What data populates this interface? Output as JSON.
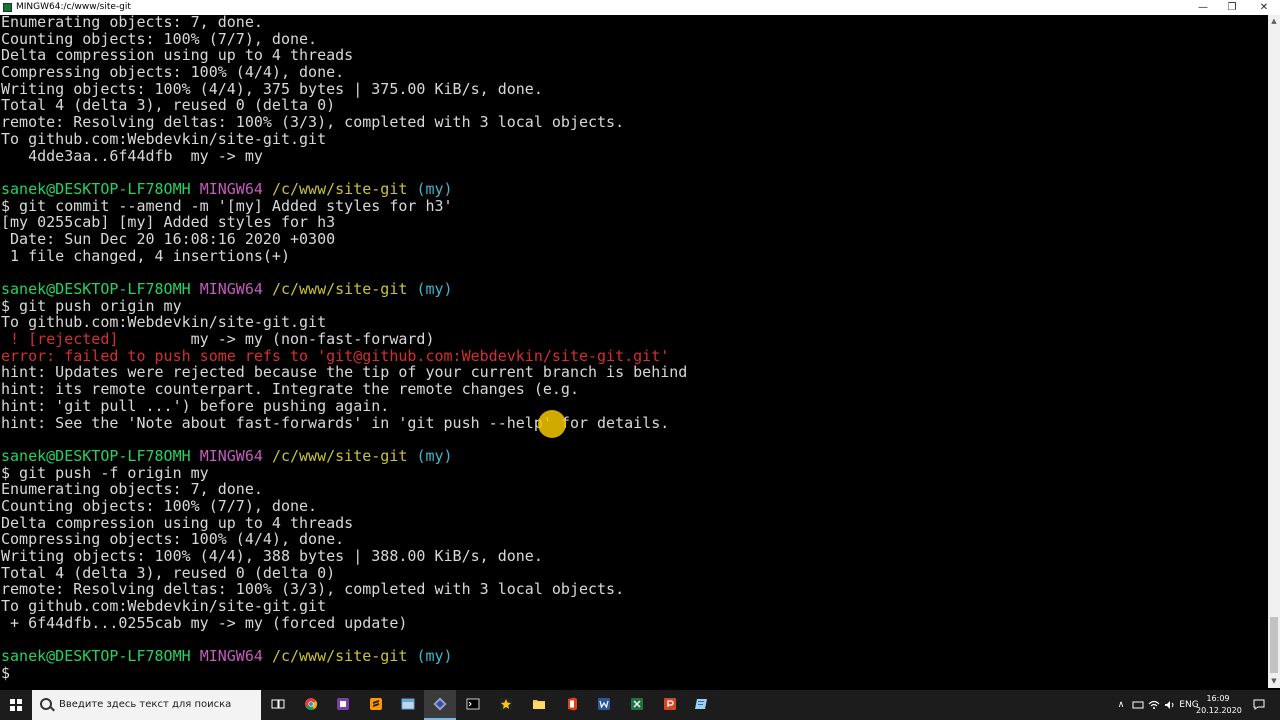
{
  "window": {
    "title": "MINGW64:/c/www/site-git",
    "minimize": "—",
    "maximize": "❐",
    "close": "✕"
  },
  "colors": {
    "user": "#23d35f",
    "mingw": "#c45cbd",
    "path": "#c9c23a",
    "branch": "#3fb6cc",
    "error": "#d32f2f",
    "text": "#d8d8d8"
  },
  "terminal": {
    "lines": [
      [
        {
          "t": "Enumerating objects: 7, done."
        }
      ],
      [
        {
          "t": "Counting objects: 100% (7/7), done."
        }
      ],
      [
        {
          "t": "Delta compression using up to 4 threads"
        }
      ],
      [
        {
          "t": "Compressing objects: 100% (4/4), done."
        }
      ],
      [
        {
          "t": "Writing objects: 100% (4/4), 375 bytes | 375.00 KiB/s, done."
        }
      ],
      [
        {
          "t": "Total 4 (delta 3), reused 0 (delta 0)"
        }
      ],
      [
        {
          "t": "remote: Resolving deltas: 100% (3/3), completed with 3 local objects."
        }
      ],
      [
        {
          "t": "To github.com:Webdevkin/site-git.git"
        }
      ],
      [
        {
          "t": "   4dde3aa..6f44dfb  my -> my"
        }
      ],
      [
        {
          "t": ""
        }
      ],
      [
        {
          "t": "sanek@DESKTOP-LF78OMH",
          "c": "user"
        },
        {
          "t": " "
        },
        {
          "t": "MINGW64",
          "c": "mingw"
        },
        {
          "t": " "
        },
        {
          "t": "/c/www/site-git",
          "c": "path"
        },
        {
          "t": " "
        },
        {
          "t": "(my)",
          "c": "branch"
        }
      ],
      [
        {
          "t": "$ git commit --amend -m '[my] Added styles for h3'"
        }
      ],
      [
        {
          "t": "[my 0255cab] [my] Added styles for h3"
        }
      ],
      [
        {
          "t": " Date: Sun Dec 20 16:08:16 2020 +0300"
        }
      ],
      [
        {
          "t": " 1 file changed, 4 insertions(+)"
        }
      ],
      [
        {
          "t": ""
        }
      ],
      [
        {
          "t": "sanek@DESKTOP-LF78OMH",
          "c": "user"
        },
        {
          "t": " "
        },
        {
          "t": "MINGW64",
          "c": "mingw"
        },
        {
          "t": " "
        },
        {
          "t": "/c/www/site-git",
          "c": "path"
        },
        {
          "t": " "
        },
        {
          "t": "(my)",
          "c": "branch"
        }
      ],
      [
        {
          "t": "$ git push origin my"
        }
      ],
      [
        {
          "t": "To github.com:Webdevkin/site-git.git"
        }
      ],
      [
        {
          "t": " ! [rejected]        ",
          "c": "error"
        },
        {
          "t": "my -> my (non-fast-forward)"
        }
      ],
      [
        {
          "t": "error: failed to push some refs to 'git@github.com:Webdevkin/site-git.git'",
          "c": "error"
        }
      ],
      [
        {
          "t": "hint: Updates were rejected because the tip of your current branch is behind"
        }
      ],
      [
        {
          "t": "hint: its remote counterpart. Integrate the remote changes (e.g."
        }
      ],
      [
        {
          "t": "hint: 'git pull ...') before pushing again."
        }
      ],
      [
        {
          "t": "hint: See the 'Note about fast-forwards' in 'git push --help' for details."
        }
      ],
      [
        {
          "t": ""
        }
      ],
      [
        {
          "t": "sanek@DESKTOP-LF78OMH",
          "c": "user"
        },
        {
          "t": " "
        },
        {
          "t": "MINGW64",
          "c": "mingw"
        },
        {
          "t": " "
        },
        {
          "t": "/c/www/site-git",
          "c": "path"
        },
        {
          "t": " "
        },
        {
          "t": "(my)",
          "c": "branch"
        }
      ],
      [
        {
          "t": "$ git push -f origin my"
        }
      ],
      [
        {
          "t": "Enumerating objects: 7, done."
        }
      ],
      [
        {
          "t": "Counting objects: 100% (7/7), done."
        }
      ],
      [
        {
          "t": "Delta compression using up to 4 threads"
        }
      ],
      [
        {
          "t": "Compressing objects: 100% (4/4), done."
        }
      ],
      [
        {
          "t": "Writing objects: 100% (4/4), 388 bytes | 388.00 KiB/s, done."
        }
      ],
      [
        {
          "t": "Total 4 (delta 3), reused 0 (delta 0)"
        }
      ],
      [
        {
          "t": "remote: Resolving deltas: 100% (3/3), completed with 3 local objects."
        }
      ],
      [
        {
          "t": "To github.com:Webdevkin/site-git.git"
        }
      ],
      [
        {
          "t": " + 6f44dfb...0255cab my -> my (forced update)"
        }
      ],
      [
        {
          "t": ""
        }
      ],
      [
        {
          "t": "sanek@DESKTOP-LF78OMH",
          "c": "user"
        },
        {
          "t": " "
        },
        {
          "t": "MINGW64",
          "c": "mingw"
        },
        {
          "t": " "
        },
        {
          "t": "/c/www/site-git",
          "c": "path"
        },
        {
          "t": " "
        },
        {
          "t": "(my)",
          "c": "branch"
        }
      ],
      [
        {
          "t": "$"
        }
      ]
    ]
  },
  "taskbar": {
    "search_placeholder": "Введите здесь текст для поиска",
    "apps": [
      {
        "icon": "task-view-icon",
        "label": "Task View"
      },
      {
        "icon": "chrome-icon",
        "label": "Google Chrome"
      },
      {
        "icon": "app-purple-icon",
        "label": "App"
      },
      {
        "icon": "sublime-text-icon",
        "label": "Sublime Text"
      },
      {
        "icon": "app-window-icon",
        "label": "Window"
      },
      {
        "icon": "git-bash-icon",
        "label": "Git Bash",
        "active": true
      },
      {
        "icon": "terminal-icon",
        "label": "Terminal"
      },
      {
        "icon": "star-app-icon",
        "label": "App"
      },
      {
        "icon": "file-explorer-icon",
        "label": "File Explorer"
      },
      {
        "icon": "office-icon",
        "label": "Office"
      },
      {
        "icon": "word-icon",
        "label": "Word"
      },
      {
        "icon": "excel-icon",
        "label": "Excel"
      },
      {
        "icon": "powerpoint-icon",
        "label": "PowerPoint"
      },
      {
        "icon": "notes-icon",
        "label": "Notes"
      }
    ],
    "tray": {
      "chevron": "∧",
      "language": "ENG",
      "time": "16:09",
      "date": "20.12.2020"
    }
  }
}
